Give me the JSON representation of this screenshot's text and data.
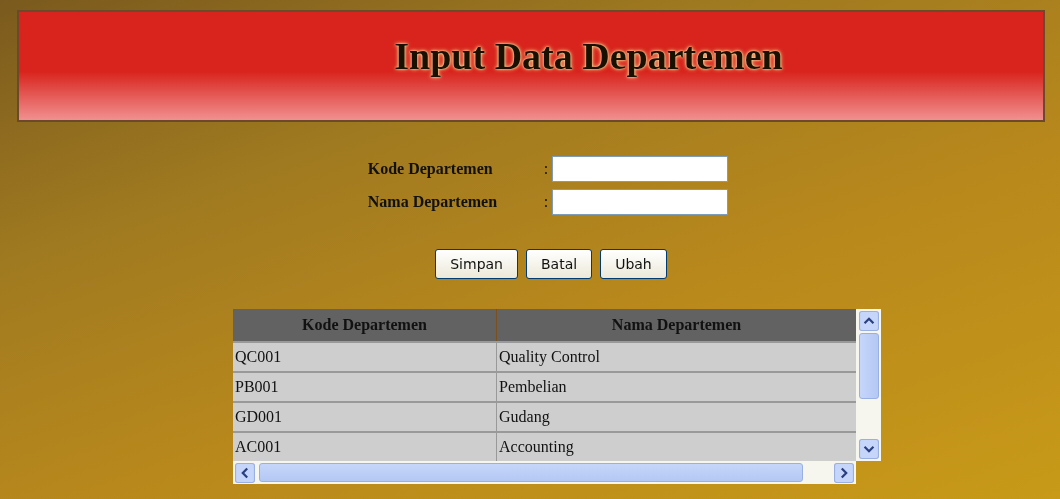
{
  "header": {
    "title": "Input Data Departemen"
  },
  "form": {
    "fields": [
      {
        "label": "Kode Departemen",
        "separator": ":"
      },
      {
        "label": "Nama Departemen",
        "separator": ":"
      }
    ]
  },
  "buttons": [
    "Simpan",
    "Batal",
    "Ubah"
  ],
  "table": {
    "columns": [
      "Kode Departemen",
      "Nama Departemen"
    ],
    "rows": [
      [
        "QC001",
        "Quality Control"
      ],
      [
        "PB001",
        "Pembelian"
      ],
      [
        "GD001",
        "Gudang"
      ],
      [
        "AC001",
        "Accounting"
      ]
    ]
  }
}
